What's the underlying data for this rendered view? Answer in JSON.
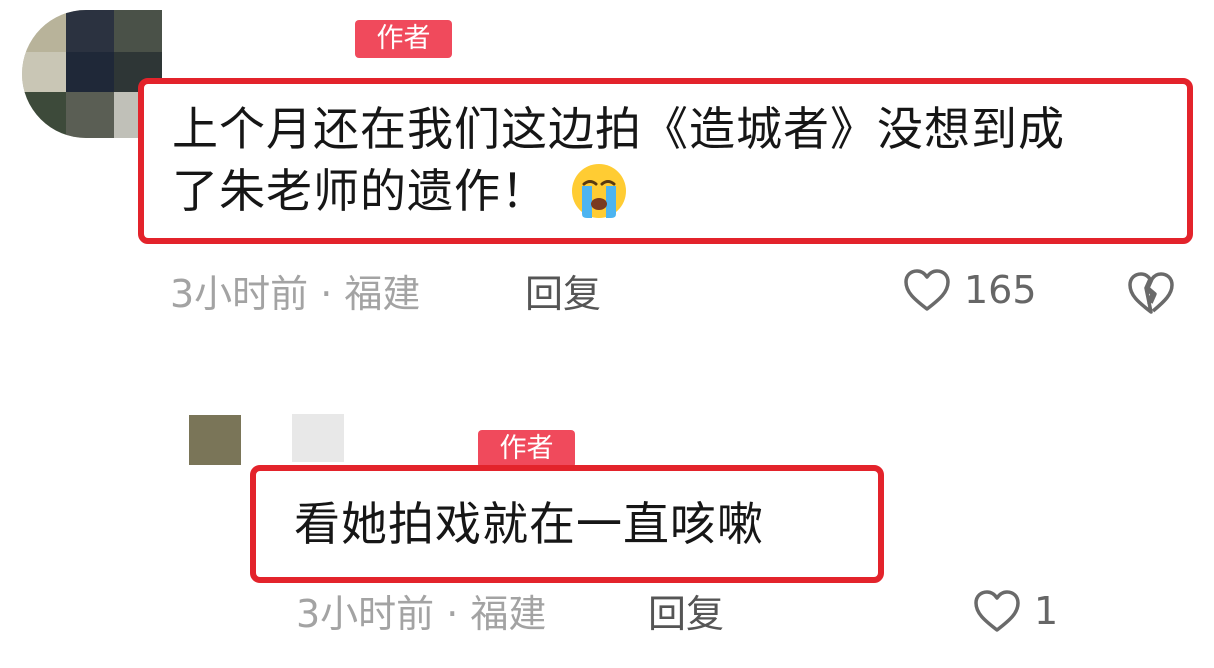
{
  "comments": [
    {
      "badge": "作者",
      "text_line1": "上个月还在我们这边拍《造城者》没想到成",
      "text_line2": "了朱老师的遗作！",
      "emoji": "loudly-crying-face-icon",
      "meta": "3小时前 · 福建",
      "reply_label": "回复",
      "likes": "165"
    }
  ],
  "replies": [
    {
      "badge": "作者",
      "text": "看她拍戏就在一直咳嗽",
      "meta": "3小时前 · 福建",
      "reply_label": "回复",
      "likes": "1"
    }
  ],
  "colors": {
    "highlight_border": "#e3232b",
    "badge_bg": "#f04a5c",
    "meta_text": "#a3a3a3"
  }
}
